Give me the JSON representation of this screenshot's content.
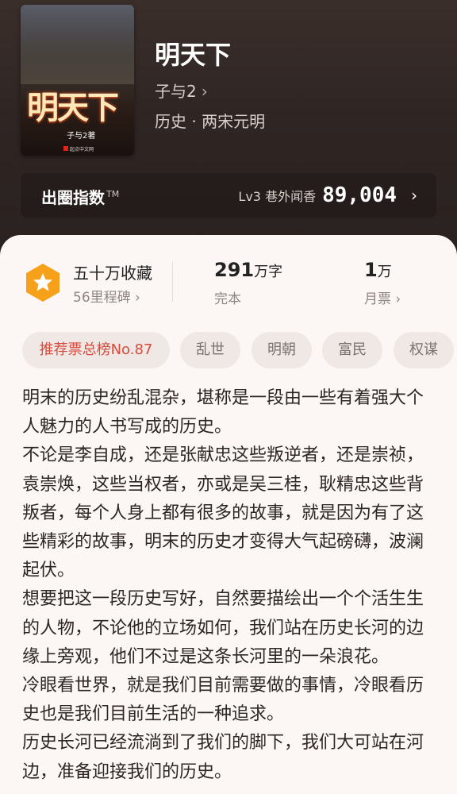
{
  "book": {
    "title": "明天下",
    "author": "子与2",
    "author_chevron": "›",
    "genre": "历史 · 两宋元明",
    "cover": {
      "title": "明天下",
      "author": "子与2著",
      "publisher": "起点中文网"
    }
  },
  "index": {
    "label": "出圈指数",
    "tm": "TM",
    "level": "Lv3 巷外闻香",
    "value": "89,004",
    "chevron": "›"
  },
  "stats": {
    "collection": {
      "title": "五十万收藏",
      "sub": "56里程碑 ›"
    },
    "words": {
      "value": "291",
      "unit": "万字",
      "sub": "完本"
    },
    "tickets": {
      "value": "1",
      "unit": "万",
      "sub": "月票 ›"
    }
  },
  "tags": [
    "推荐票总榜No.87",
    "乱世",
    "明朝",
    "富民",
    "权谋"
  ],
  "colors": {
    "accent_orange": "#f7a11a",
    "tag_hot": "#d94a3c"
  },
  "description": [
    "明末的历史纷乱混杂，堪称是一段由一些有着强大个人魅力的人书写成的历史。",
    "不论是李自成，还是张献忠这些叛逆者，还是崇祯，袁崇焕，这些当权者，亦或是吴三桂，耿精忠这些背叛者，每个人身上都有很多的故事，就是因为有了这些精彩的故事，明末的历史才变得大气起磅礴，波澜起伏。",
    "想要把这一段历史写好，自然要描绘出一个个活生生的人物，不论他的立场如何，我们站在历史长河的边缘上旁观，他们不过是这条长河里的一朵浪花。",
    "冷眼看世界，就是我们目前需要做的事情，冷眼看历史也是我们目前生活的一种追求。",
    "历史长河已经流淌到了我们的脚下，我们大可站在河边，准备迎接我们的历史。"
  ]
}
